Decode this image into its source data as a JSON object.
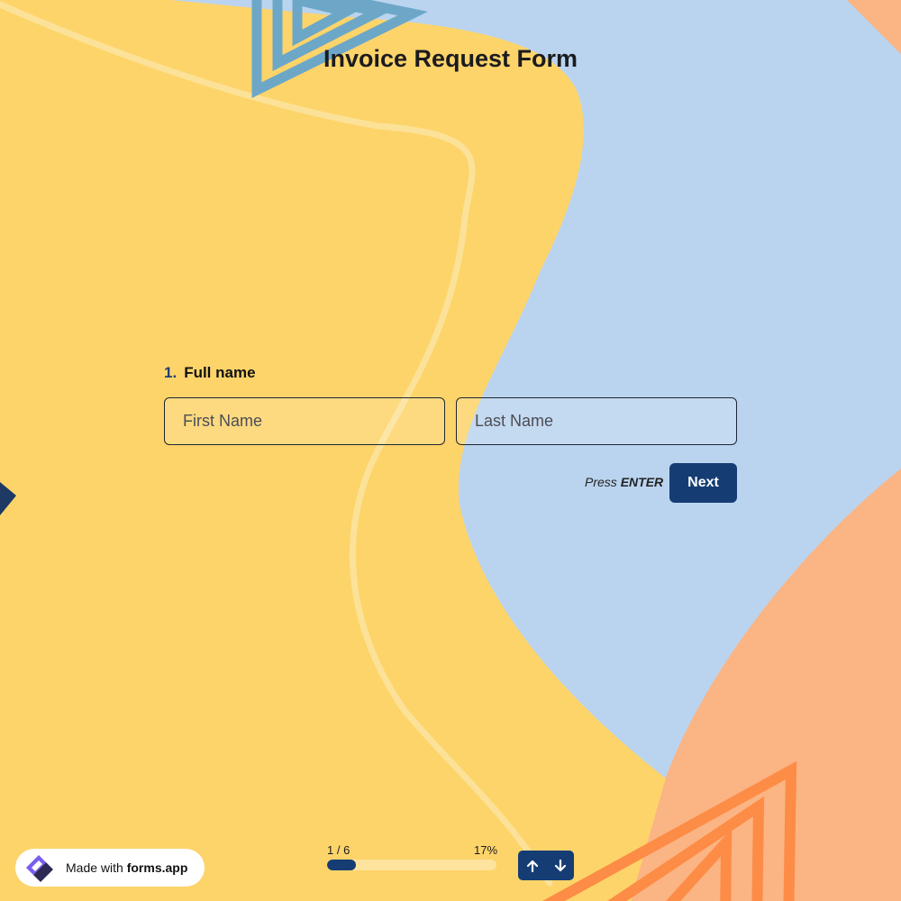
{
  "form": {
    "title": "Invoice Request Form",
    "question_number": "1.",
    "question_label": "Full name",
    "first_name_placeholder": "First Name",
    "last_name_placeholder": "Last Name",
    "first_name_value": "",
    "last_name_value": "",
    "hint_prefix": "Press",
    "hint_key": "ENTER",
    "next_label": "Next"
  },
  "progress": {
    "step_text": "1 / 6",
    "percent_text": "17%",
    "fraction": 0.17
  },
  "badge": {
    "prefix": "Made with",
    "brand": "forms.app"
  },
  "icons": {
    "badge_logo": "forms-app-logo-icon",
    "prev": "arrow-up-icon",
    "next": "arrow-down-icon"
  },
  "colors": {
    "background_yellow": "#fdd46a",
    "background_blue": "#bad4ef",
    "background_peach": "#fbb483",
    "accent_navy": "#153d74",
    "triangle_blue": "#6da7c7",
    "triangle_orange": "#fd8c46"
  }
}
